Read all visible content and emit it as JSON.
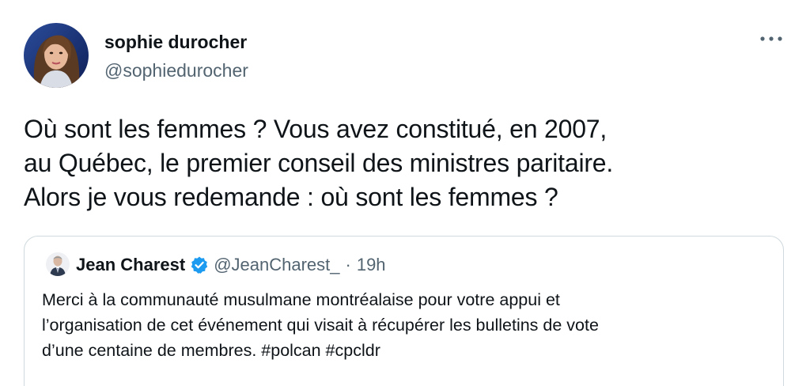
{
  "author": {
    "display_name": "sophie durocher",
    "handle": "@sophiedurocher"
  },
  "more_icon": "more-horizontal-icon",
  "tweet": {
    "text": "Où sont les femmes ? Vous avez constitué, en 2007,\nau Québec, le premier conseil des ministres paritaire.\nAlors je vous redemande : où sont les femmes ?"
  },
  "quoted_tweet": {
    "display_name": "Jean Charest",
    "verified_icon": "verified-badge-icon",
    "handle": "@JeanCharest_",
    "separator": "·",
    "time": "19h",
    "text": "Merci à la communauté musulmane montréalaise pour votre appui et\nl’organisation de cet événement qui visait à récupérer les bulletins de vote\nd’une centaine de membres. #polcan #cpcldr"
  },
  "colors": {
    "text_primary": "#0f1419",
    "text_secondary": "#536471",
    "verified_blue": "#1d9bf0",
    "border": "#cfd9de"
  }
}
